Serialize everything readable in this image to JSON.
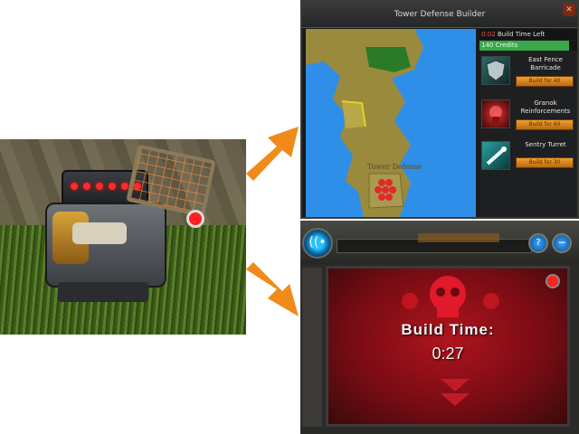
{
  "window": {
    "title": "Tower Defense Builder",
    "close_icon": "close-icon"
  },
  "map": {
    "label": "Tower Defense"
  },
  "panel": {
    "timer_value": "0:02",
    "timer_text": "Build Time Left",
    "credits": "140 Credits",
    "credits_fill_pct": 92,
    "items": [
      {
        "name": "East Fence Barricade",
        "button": "Build for 40",
        "icon": "shield-icon"
      },
      {
        "name": "Granok Reinforcements",
        "button": "Build for 60",
        "icon": "warrior-icon"
      },
      {
        "name": "Sentry Turret",
        "button": "Build for 30",
        "icon": "turret-icon"
      }
    ]
  },
  "bottom": {
    "build_label": "Build Time:",
    "build_time": "0:27",
    "help_label": "?",
    "minimize_label": "−",
    "signal_label": "((•"
  },
  "colors": {
    "accent": "#f0a030",
    "credits": "#3aa84a",
    "alert": "#b0141e",
    "sea": "#2f8fe8"
  }
}
